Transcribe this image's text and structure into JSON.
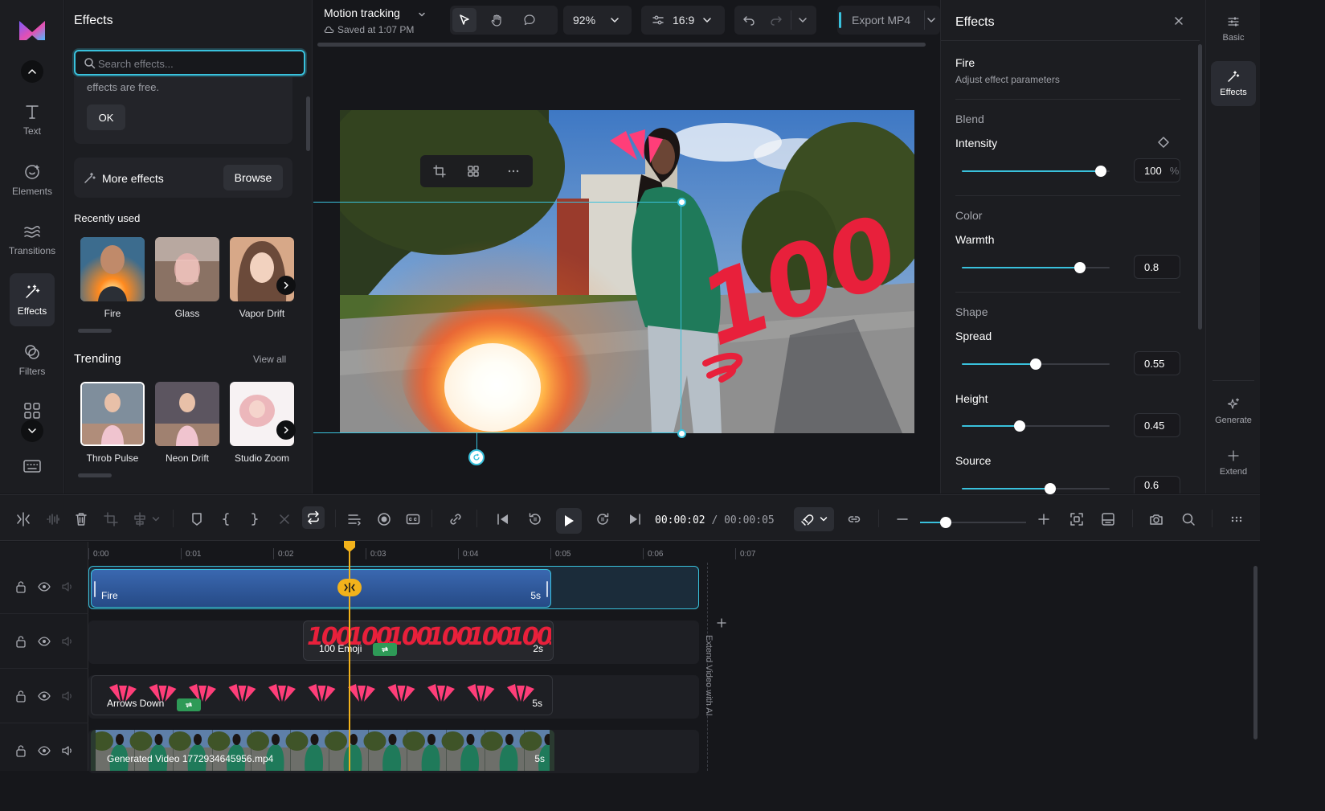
{
  "rail": {
    "items": [
      {
        "label": "Text"
      },
      {
        "label": "Elements"
      },
      {
        "label": "Transitions"
      },
      {
        "label": "Effects"
      },
      {
        "label": "Filters"
      }
    ]
  },
  "library": {
    "title": "Effects",
    "search_placeholder": "Search effects...",
    "notice_text": "effects are free.",
    "ok_label": "OK",
    "more_effects_label": "More effects",
    "browse_label": "Browse",
    "recently_used_title": "Recently used",
    "recently_used": [
      {
        "label": "Fire"
      },
      {
        "label": "Glass"
      },
      {
        "label": "Vapor Drift"
      }
    ],
    "trending_title": "Trending",
    "view_all_label": "View all",
    "trending": [
      {
        "label": "Throb Pulse"
      },
      {
        "label": "Neon Drift"
      },
      {
        "label": "Studio Zoom"
      }
    ]
  },
  "topbar": {
    "project_title": "Motion tracking",
    "saved_text": "Saved at 1:07 PM",
    "zoom": "92%",
    "aspect": "16:9",
    "export_label": "Export MP4"
  },
  "properties": {
    "title": "Effects",
    "effect_name": "Fire",
    "effect_desc": "Adjust effect parameters",
    "groups": {
      "blend": "Blend",
      "color": "Color",
      "shape": "Shape"
    },
    "params": {
      "intensity": {
        "label": "Intensity",
        "value": "100",
        "unit": "%",
        "fraction": 0.94
      },
      "warmth": {
        "label": "Warmth",
        "value": "0.8",
        "fraction": 0.8
      },
      "spread": {
        "label": "Spread",
        "value": "0.55",
        "fraction": 0.5
      },
      "height": {
        "label": "Height",
        "value": "0.45",
        "fraction": 0.39
      },
      "source": {
        "label": "Source",
        "value": "0.6",
        "fraction": 0.6
      }
    }
  },
  "far_rail": {
    "basic": "Basic",
    "effects": "Effects",
    "generate": "Generate",
    "extend": "Extend"
  },
  "timeline": {
    "current_time": "00:00:02",
    "separator": " / ",
    "total_time": "00:00:05",
    "ruler": [
      "0:00",
      "0:01",
      "0:02",
      "0:03",
      "0:04",
      "0:05",
      "0:06",
      "0:07"
    ],
    "extend_label": "Extend Video with AI",
    "clips": [
      {
        "label": "Fire",
        "duration": "5s"
      },
      {
        "label": "100 Emoji",
        "duration": "2s"
      },
      {
        "label": "Arrows Down",
        "duration": "5s"
      },
      {
        "label": "Generated Video 1772934645956.mp4",
        "duration": "5s"
      }
    ],
    "emoji_text": "100",
    "zoom_fraction": 0.24
  },
  "colors": {
    "accent": "#39c1dc",
    "playhead": "#f2b21b",
    "fire_clip": "#2f5aa0",
    "link_badge": "#2e9a57",
    "emoji_red": "#e8203b"
  }
}
